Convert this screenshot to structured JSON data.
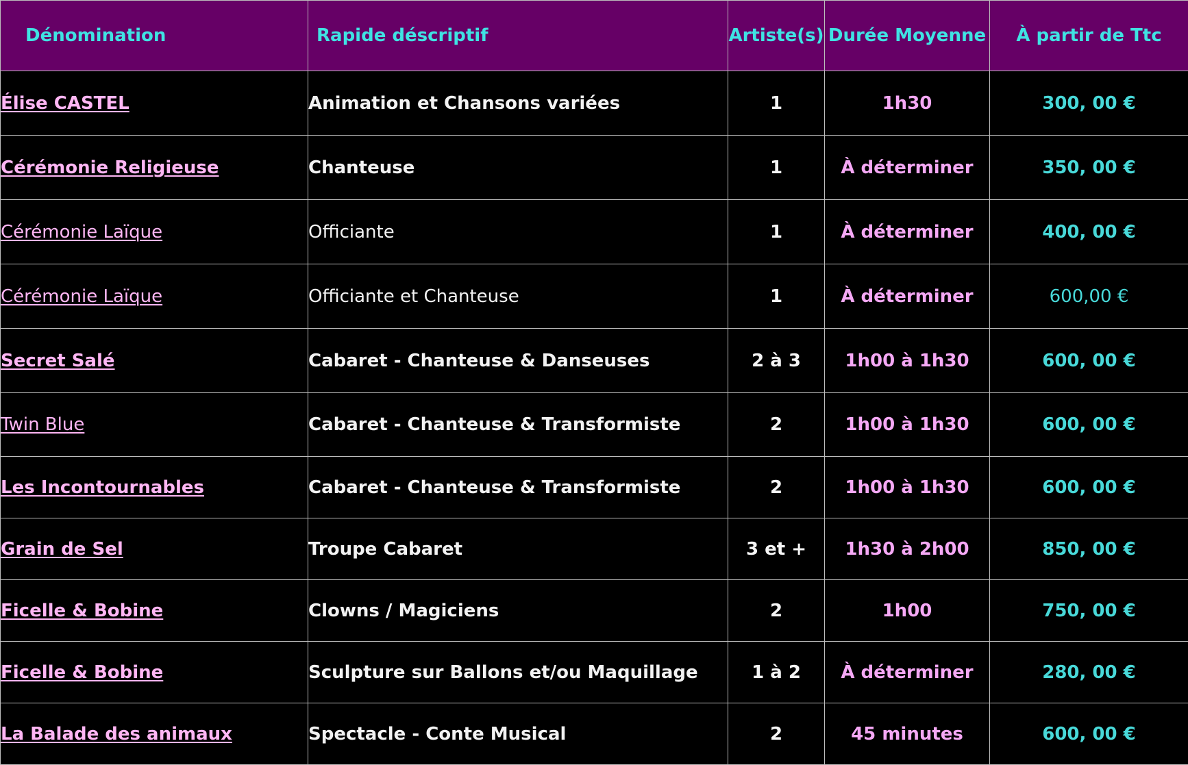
{
  "header": {
    "name": "Dénomination",
    "description": "Rapide déscriptif",
    "artists": "Artiste(s)",
    "duration": "Durée Moyenne",
    "price": "À partir de Ttc"
  },
  "colors": {
    "header_bg": "#660066",
    "header_text": "#3fe3e3",
    "link": "#ffb6f4",
    "duration": "#f5a8f5",
    "price": "#48d9d9",
    "body_bg": "#000000",
    "grid_lines": "#bdbdbd"
  },
  "rows": [
    {
      "name": "Élise CASTEL",
      "description": "Animation et Chansons variées",
      "artists": "1",
      "duration": "1h30",
      "price": "300, 00 €"
    },
    {
      "name": "Cérémonie Religieuse",
      "description": "Chanteuse",
      "artists": "1",
      "duration": "À déterminer",
      "price": "350, 00 €"
    },
    {
      "name": "Cérémonie Laïque",
      "description": "Officiante",
      "artists": "1",
      "duration": "À déterminer",
      "price": "400, 00 €"
    },
    {
      "name": "Cérémonie Laïque",
      "description": "Officiante et Chanteuse",
      "artists": "1",
      "duration": "À déterminer",
      "price": "600,00 €"
    },
    {
      "name": "Secret Salé",
      "description": "Cabaret - Chanteuse & Danseuses",
      "artists": "2 à 3",
      "duration": "1h00 à 1h30",
      "price": "600, 00 €"
    },
    {
      "name": "Twin Blue",
      "description": "Cabaret - Chanteuse & Transformiste",
      "artists": "2",
      "duration": "1h00 à 1h30",
      "price": "600, 00 €"
    },
    {
      "name": "Les Incontournables",
      "description": "Cabaret - Chanteuse & Transformiste",
      "artists": "2",
      "duration": "1h00 à 1h30",
      "price": "600, 00 €"
    },
    {
      "name": "Grain de Sel",
      "description": "Troupe Cabaret",
      "artists": "3 et +",
      "duration": "1h30 à 2h00",
      "price": "850, 00 €"
    },
    {
      "name": "Ficelle & Bobine",
      "description": "Clowns / Magiciens",
      "artists": "2",
      "duration": "1h00",
      "price": "750, 00 €"
    },
    {
      "name": "Ficelle & Bobine",
      "description": "Sculpture sur Ballons et/ou Maquillage",
      "artists": "1 à 2",
      "duration": "À déterminer",
      "price": "280, 00 €"
    },
    {
      "name": "La Balade des animaux",
      "description": "Spectacle - Conte Musical",
      "artists": "2",
      "duration": "45 minutes",
      "price": "600, 00 €"
    }
  ]
}
